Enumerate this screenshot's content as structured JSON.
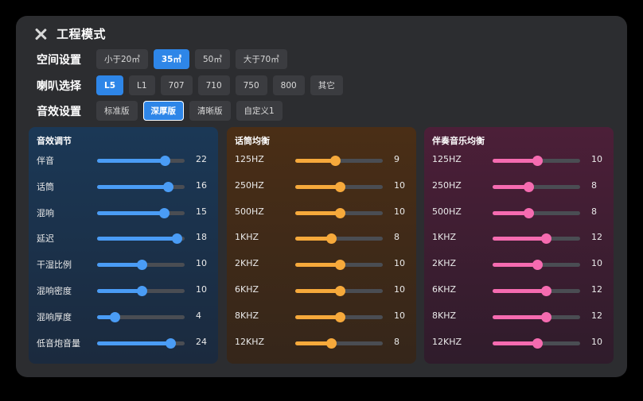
{
  "header": {
    "title": "工程模式"
  },
  "rows": [
    {
      "label": "空间设置",
      "options": [
        "小于20㎡",
        "35㎡",
        "50㎡",
        "大于70㎡"
      ],
      "selected": 1
    },
    {
      "label": "喇叭选择",
      "options": [
        "L5",
        "L1",
        "707",
        "710",
        "750",
        "800",
        "其它"
      ],
      "selected": 0
    },
    {
      "label": "音效设置",
      "options": [
        "标准版",
        "深厚版",
        "清晰版",
        "自定义1"
      ],
      "selected": 1
    }
  ],
  "panels": [
    {
      "title": "音效调节",
      "color": "#4a9cf5",
      "sliders": [
        {
          "label": "伴音",
          "value": "22",
          "fraction": 0.77
        },
        {
          "label": "话筒",
          "value": "16",
          "fraction": 0.81
        },
        {
          "label": "混响",
          "value": "15",
          "fraction": 0.76
        },
        {
          "label": "延迟",
          "value": "18",
          "fraction": 0.91
        },
        {
          "label": "干湿比例",
          "value": "10",
          "fraction": 0.51
        },
        {
          "label": "混响密度",
          "value": "10",
          "fraction": 0.51
        },
        {
          "label": "混响厚度",
          "value": "4",
          "fraction": 0.2
        },
        {
          "label": "低音炮音量",
          "value": "24",
          "fraction": 0.84
        }
      ]
    },
    {
      "title": "话筒均衡",
      "color": "#f6a93b",
      "sliders": [
        {
          "label": "125HZ",
          "value": "9",
          "fraction": 0.45
        },
        {
          "label": "250HZ",
          "value": "10",
          "fraction": 0.51
        },
        {
          "label": "500HZ",
          "value": "10",
          "fraction": 0.51
        },
        {
          "label": "1KHZ",
          "value": "8",
          "fraction": 0.41
        },
        {
          "label": "2KHZ",
          "value": "10",
          "fraction": 0.51
        },
        {
          "label": "6KHZ",
          "value": "10",
          "fraction": 0.51
        },
        {
          "label": "8KHZ",
          "value": "10",
          "fraction": 0.51
        },
        {
          "label": "12KHZ",
          "value": "8",
          "fraction": 0.41
        }
      ]
    },
    {
      "title": "伴奏音乐均衡",
      "color": "#f56bb0",
      "sliders": [
        {
          "label": "125HZ",
          "value": "10",
          "fraction": 0.51
        },
        {
          "label": "250HZ",
          "value": "8",
          "fraction": 0.41
        },
        {
          "label": "500HZ",
          "value": "8",
          "fraction": 0.41
        },
        {
          "label": "1KHZ",
          "value": "12",
          "fraction": 0.61
        },
        {
          "label": "2KHZ",
          "value": "10",
          "fraction": 0.51
        },
        {
          "label": "6KHZ",
          "value": "12",
          "fraction": 0.61
        },
        {
          "label": "8KHZ",
          "value": "12",
          "fraction": 0.61
        },
        {
          "label": "12KHZ",
          "value": "10",
          "fraction": 0.51
        }
      ]
    }
  ]
}
